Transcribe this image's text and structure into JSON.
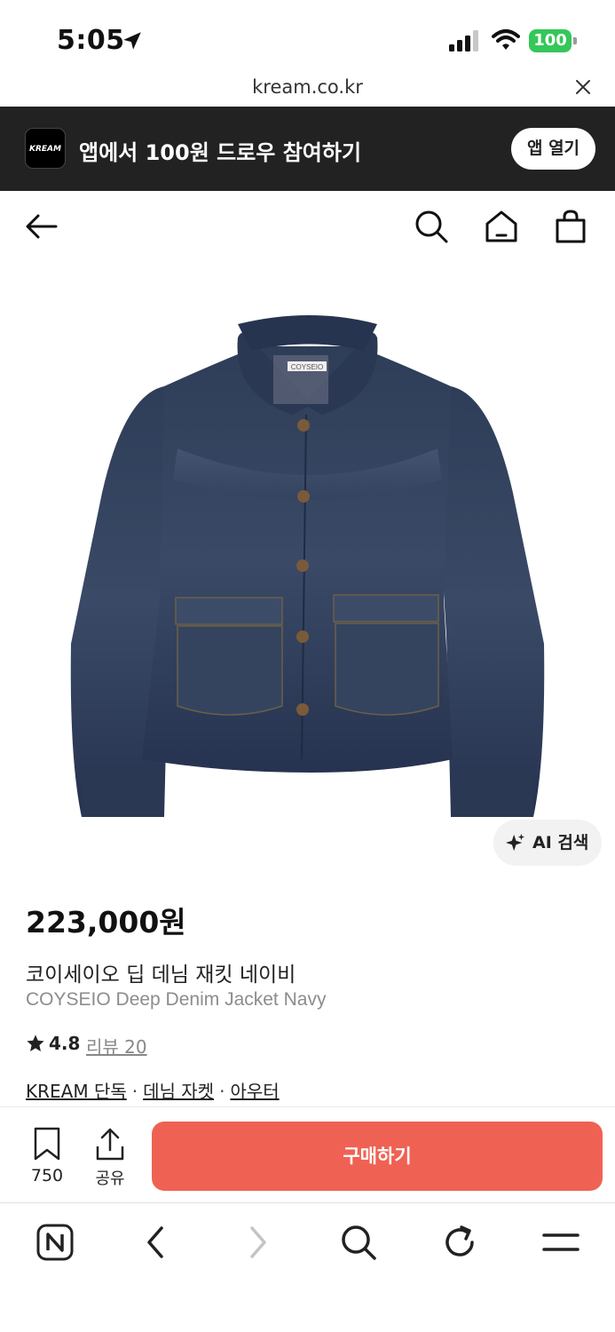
{
  "status_bar": {
    "time": "5:05",
    "battery": "100",
    "icons": [
      "location-arrow-icon",
      "signal-icon",
      "wifi-icon",
      "battery-icon"
    ]
  },
  "url_bar": {
    "url": "kream.co.kr"
  },
  "app_banner": {
    "logo_text": "KREAM",
    "message": "앱에서 100원 드로우 참여하기",
    "open_app_label": "앱 열기"
  },
  "top_nav": {
    "icons": [
      "back-arrow-icon",
      "search-icon",
      "home-icon",
      "shopping-bag-icon"
    ]
  },
  "product": {
    "image_label": "COYSEIO",
    "ai_search_label": "AI 검색",
    "price": "223,000원",
    "name_ko": "코이세이오 딥 데님 재킷 네이비",
    "name_en": "COYSEIO Deep Denim Jacket Navy",
    "rating": "4.8",
    "review_label": "리뷰 20",
    "tags": [
      "KREAM 단독",
      "데님 자켓",
      "아우터"
    ],
    "tag_separator": "·"
  },
  "action_bar": {
    "bookmark_count": "750",
    "share_label": "공유",
    "buy_label": "구매하기"
  },
  "browser_toolbar": {
    "icons": [
      "naver-n-icon",
      "back-chevron-icon",
      "forward-chevron-icon",
      "search-icon",
      "refresh-icon",
      "menu-icon"
    ]
  },
  "colors": {
    "banner_bg": "#222222",
    "buy_button": "#ef6253",
    "battery_green": "#34c759",
    "denim": "#2c3b55"
  }
}
